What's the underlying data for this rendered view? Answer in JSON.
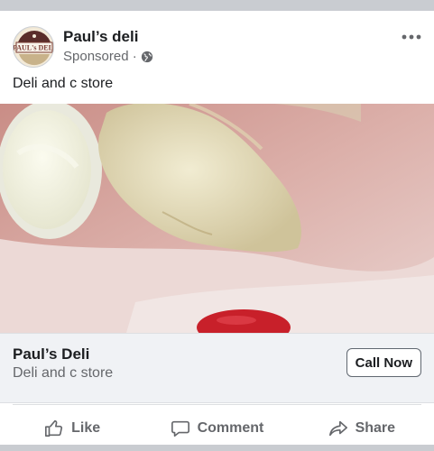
{
  "post": {
    "page_name": "Paul’s deli",
    "sponsored": "Sponsored ·",
    "body_text": "Deli and c store",
    "avatar_logo_text": "PAUL's DELI"
  },
  "link_preview": {
    "title": "Paul’s Deli",
    "description": "Deli and c store",
    "cta_label": "Call Now"
  },
  "actions": {
    "like": "Like",
    "comment": "Comment",
    "share": "Share"
  },
  "colors": {
    "band": "#c9ccd1",
    "secondary_text": "#65676b",
    "primary_text": "#1c1e21"
  }
}
